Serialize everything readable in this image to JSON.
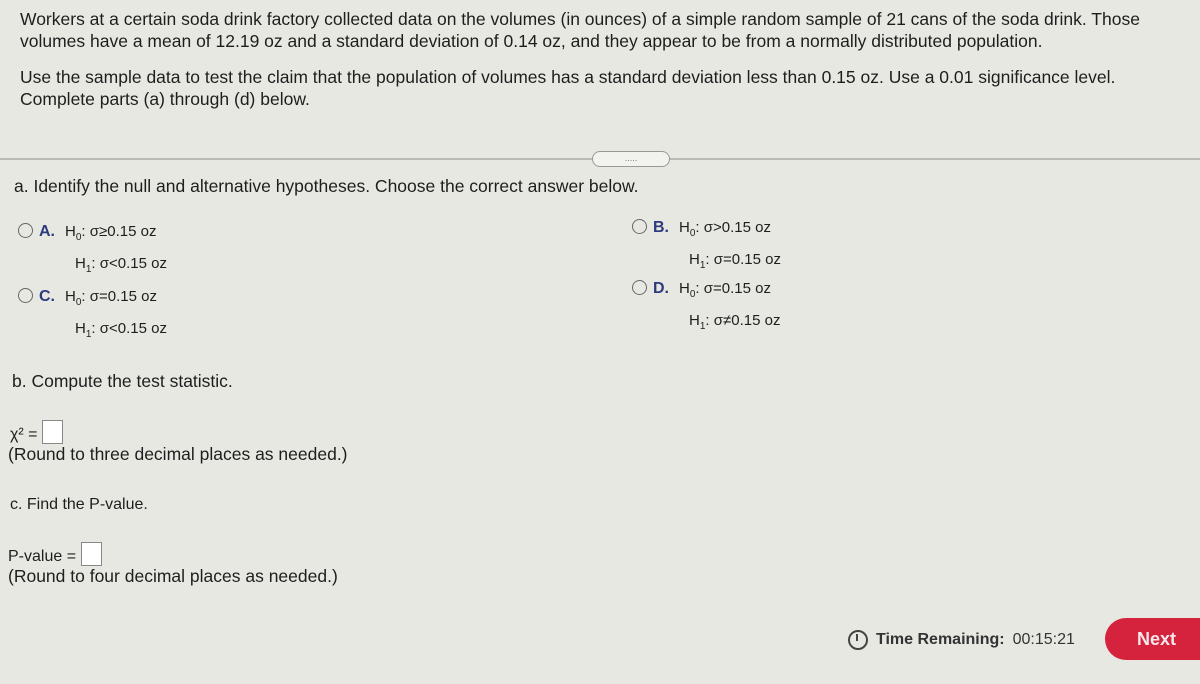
{
  "question": {
    "paragraph1": "Workers at a certain soda drink factory collected data on the volumes (in ounces) of a simple random sample of 21 cans of the soda drink. Those volumes have a mean of 12.19 oz and a standard deviation of 0.14 oz, and they appear to be from a normally distributed population.",
    "paragraph2": "Use the sample data to test the claim that the population of volumes has a standard deviation less than 0.15 oz. Use a 0.01 significance level. Complete parts (a) through (d) below."
  },
  "more_button": ".....",
  "part_a": {
    "prompt": "a. Identify the null and alternative hypotheses. Choose the correct answer below.",
    "options": [
      {
        "letter": "A.",
        "h0": "σ≥0.15 oz",
        "h1": "σ<0.15 oz"
      },
      {
        "letter": "B.",
        "h0": "σ>0.15 oz",
        "h1": "σ=0.15 oz"
      },
      {
        "letter": "C.",
        "h0": "σ=0.15 oz",
        "h1": "σ<0.15 oz"
      },
      {
        "letter": "D.",
        "h0": "σ=0.15 oz",
        "h1": "σ≠0.15 oz"
      }
    ]
  },
  "part_b": {
    "prompt": "b. Compute the test statistic.",
    "label": "χ² =",
    "value": "",
    "note": "(Round to three decimal places as needed.)"
  },
  "part_c": {
    "prompt": "c. Find the P-value.",
    "label": "P-value =",
    "value": "",
    "note": "(Round to four decimal places as needed.)"
  },
  "footer": {
    "time_label": "Time Remaining:",
    "time_value": "00:15:21",
    "next_label": "Next"
  },
  "colors": {
    "next_button": "#d5223d",
    "option_letter": "#2d3a7c",
    "background": "#e8e8e3"
  }
}
